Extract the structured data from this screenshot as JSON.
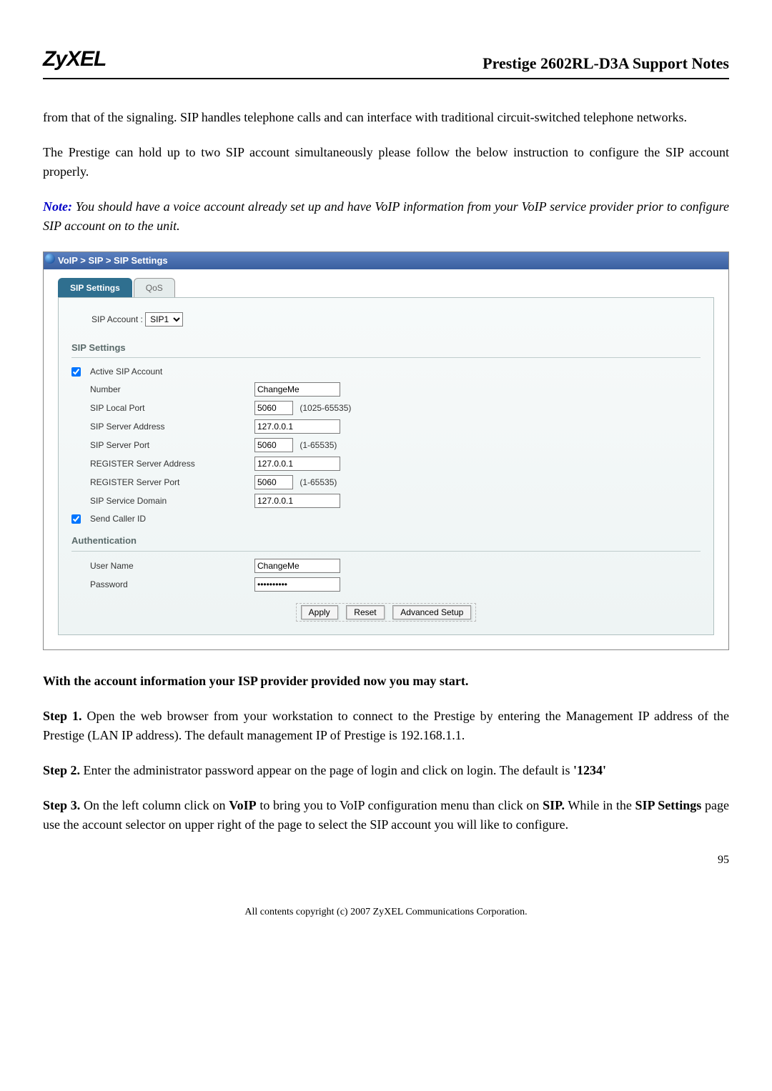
{
  "header": {
    "logo": "ZyXEL",
    "title": "Prestige 2602RL-D3A Support Notes"
  },
  "intro": {
    "p1": "from that of the signaling. SIP handles telephone calls and can interface with traditional circuit-switched telephone networks.",
    "p2": "The Prestige can hold up to two SIP account simultaneously please follow the below instruction to configure the SIP account properly.",
    "note_label": "Note:",
    "note": " You should have a voice account already set up and have VoIP information from your VoIP service provider prior to configure SIP account on to the unit."
  },
  "screenshot": {
    "breadcrumb": "VoIP > SIP > SIP Settings",
    "tabs": [
      {
        "label": "SIP Settings",
        "active": true
      },
      {
        "label": "QoS",
        "active": false
      }
    ],
    "account_selector": {
      "label": "SIP Account :",
      "value": "SIP1"
    },
    "sections": {
      "sip_header": "SIP Settings",
      "auth_header": "Authentication"
    },
    "sip": {
      "active_label": "Active SIP Account",
      "active_checked": true,
      "number_label": "Number",
      "number_value": "ChangeMe",
      "local_port_label": "SIP Local Port",
      "local_port_value": "5060",
      "local_port_hint": "(1025-65535)",
      "server_addr_label": "SIP Server Address",
      "server_addr_value": "127.0.0.1",
      "server_port_label": "SIP Server Port",
      "server_port_value": "5060",
      "server_port_hint": "(1-65535)",
      "reg_addr_label": "REGISTER Server Address",
      "reg_addr_value": "127.0.0.1",
      "reg_port_label": "REGISTER Server Port",
      "reg_port_value": "5060",
      "reg_port_hint": "(1-65535)",
      "domain_label": "SIP Service Domain",
      "domain_value": "127.0.0.1",
      "caller_id_label": "Send Caller ID",
      "caller_id_checked": true
    },
    "auth": {
      "user_label": "User Name",
      "user_value": "ChangeMe",
      "pass_label": "Password",
      "pass_value": "••••••••••"
    },
    "buttons": {
      "apply": "Apply",
      "reset": "Reset",
      "advanced": "Advanced Setup"
    }
  },
  "after": {
    "lead": "With the account information your ISP provider provided now you may start.",
    "step1_label": "Step 1.",
    "step1": " Open the web browser from your workstation to connect to the Prestige by entering the Management IP address of the Prestige (LAN IP address).  The default management IP of Prestige is 192.168.1.1.",
    "step2_label": "Step 2.",
    "step2": " Enter the administrator password appear on the page of login and click on login. The default is ",
    "step2_val": "'1234'",
    "step3_label": "Step 3.",
    "step3_a": " On the left column click on ",
    "step3_voip": "VoIP",
    "step3_b": " to bring you to VoIP configuration menu than click on ",
    "step3_sip": "SIP.",
    "step3_c": " While in the ",
    "step3_sipset": "SIP Settings",
    "step3_d": " page use the account selector on upper right of the page to select the SIP account you will like to configure."
  },
  "footer": {
    "copyright": "All contents copyright (c) 2007 ZyXEL Communications Corporation.",
    "page": "95"
  }
}
